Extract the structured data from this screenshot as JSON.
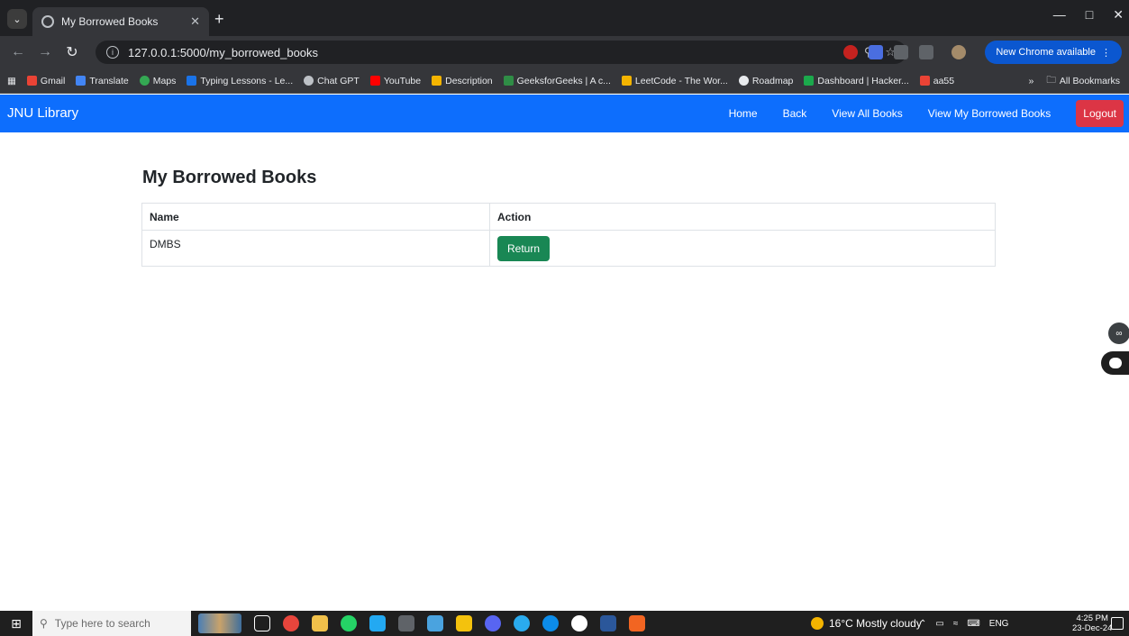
{
  "browser": {
    "tab_title": "My Borrowed Books",
    "url": "127.0.0.1:5000/my_borrowed_books",
    "update_label": "New Chrome available",
    "bookmarks": [
      "Gmail",
      "Translate",
      "Maps",
      "Typing Lessons - Le...",
      "Chat GPT",
      "YouTube",
      "Description",
      "GeeksforGeeks | A c...",
      "LeetCode - The Wor...",
      "Roadmap",
      "Dashboard | Hacker...",
      "aa55"
    ],
    "all_bookmarks_label": "All Bookmarks"
  },
  "navbar": {
    "brand": "JNU Library",
    "links": [
      "Home",
      "Back",
      "View All Books",
      "View My Borrowed Books"
    ],
    "logout_label": "Logout",
    "colors": {
      "bg": "#0d6efd",
      "logout": "#dc3545"
    }
  },
  "main": {
    "title": "My Borrowed Books",
    "table": {
      "headers": [
        "Name",
        "Action"
      ],
      "rows": [
        {
          "name": "DMBS",
          "action_label": "Return"
        }
      ]
    },
    "colors": {
      "return_button": "#198754"
    }
  },
  "taskbar": {
    "search_placeholder": "Type here to search",
    "weather": "16°C  Mostly cloudy",
    "language": "ENG",
    "time": "4:25 PM",
    "date": "23-Dec-24"
  }
}
